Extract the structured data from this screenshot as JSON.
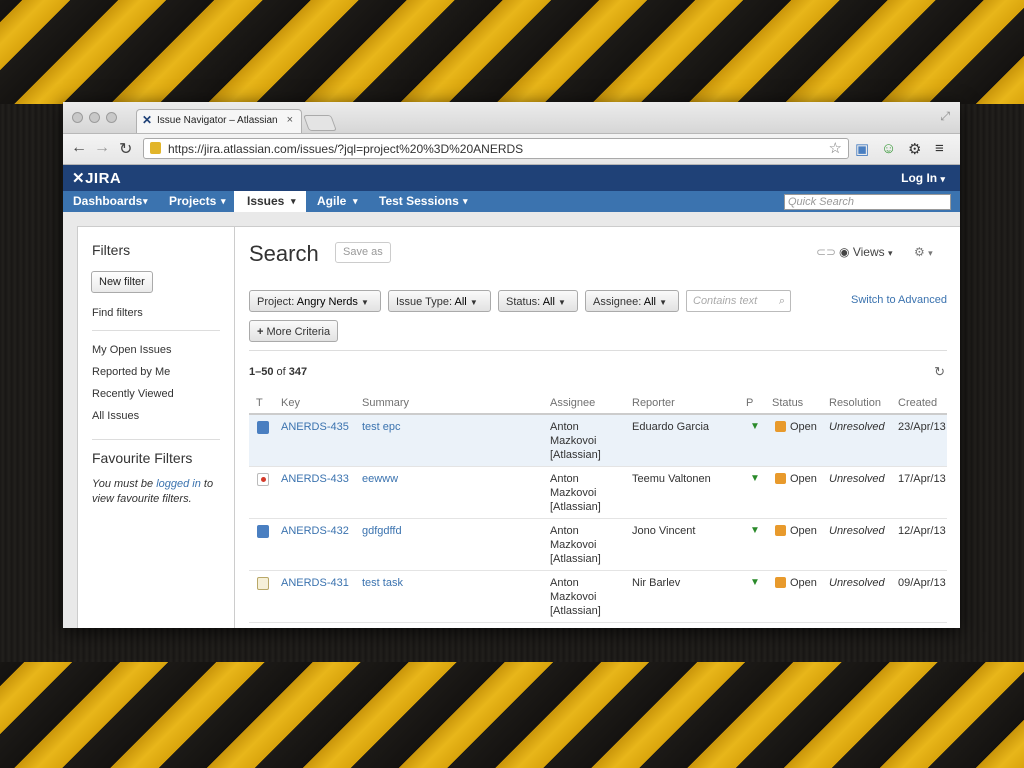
{
  "browser": {
    "tab_title": "Issue Navigator – Atlassian",
    "tab_close": "×",
    "url": "https://jira.atlassian.com/issues/?jql=project%20%3D%20ANERDS"
  },
  "header": {
    "logo": "JIRA",
    "login": "Log In"
  },
  "nav": {
    "items": [
      "Dashboards",
      "Projects",
      "Issues",
      "Agile",
      "Test Sessions"
    ],
    "active": "Issues",
    "quick_search_placeholder": "Quick Search"
  },
  "sidebar": {
    "filters_title": "Filters",
    "new_filter": "New filter",
    "find_filters": "Find filters",
    "links": [
      "My Open Issues",
      "Reported by Me",
      "Recently Viewed",
      "All Issues"
    ],
    "favourite_title": "Favourite Filters",
    "fav_note_pre": "You must be ",
    "fav_note_link": "logged in",
    "fav_note_post": " to view favourite filters."
  },
  "search": {
    "title": "Search",
    "save_as": "Save as",
    "views": "Views",
    "criteria": {
      "project": {
        "label": "Project:",
        "value": "Angry Nerds"
      },
      "issue_type": {
        "label": "Issue Type:",
        "value": "All"
      },
      "status": {
        "label": "Status:",
        "value": "All"
      },
      "assignee": {
        "label": "Assignee:",
        "value": "All"
      }
    },
    "contains_placeholder": "Contains text",
    "switch_advanced": "Switch to Advanced",
    "more_criteria": "More Criteria",
    "count_range": "1–50",
    "count_of": " of ",
    "count_total": "347"
  },
  "table": {
    "headers": [
      "T",
      "Key",
      "Summary",
      "Assignee",
      "Reporter",
      "P",
      "Status",
      "Resolution",
      "Created"
    ],
    "rows": [
      {
        "type": "epic",
        "key": "ANERDS-435",
        "summary": "test epc",
        "assignee": "Anton Mazkovoi [Atlassian]",
        "reporter": "Eduardo Garcia",
        "status": "Open",
        "resolution": "Unresolved",
        "created": "23/Apr/13"
      },
      {
        "type": "bug",
        "key": "ANERDS-433",
        "summary": "eewww",
        "assignee": "Anton Mazkovoi [Atlassian]",
        "reporter": "Teemu Valtonen",
        "status": "Open",
        "resolution": "Unresolved",
        "created": "17/Apr/13"
      },
      {
        "type": "epic",
        "key": "ANERDS-432",
        "summary": "gdfgdffd",
        "assignee": "Anton Mazkovoi [Atlassian]",
        "reporter": "Jono Vincent",
        "status": "Open",
        "resolution": "Unresolved",
        "created": "12/Apr/13"
      },
      {
        "type": "task",
        "key": "ANERDS-431",
        "summary": "test task",
        "assignee": "Anton Mazkovoi [Atlassian]",
        "reporter": "Nir Barlev",
        "status": "Open",
        "resolution": "Unresolved",
        "created": "09/Apr/13"
      }
    ]
  },
  "colors": {
    "header_bg": "#1f4177",
    "nav_bg": "#3b73af",
    "link": "#3b73af",
    "selected_row": "#ebf2f9",
    "stripe_yellow": "#e8b61a"
  }
}
